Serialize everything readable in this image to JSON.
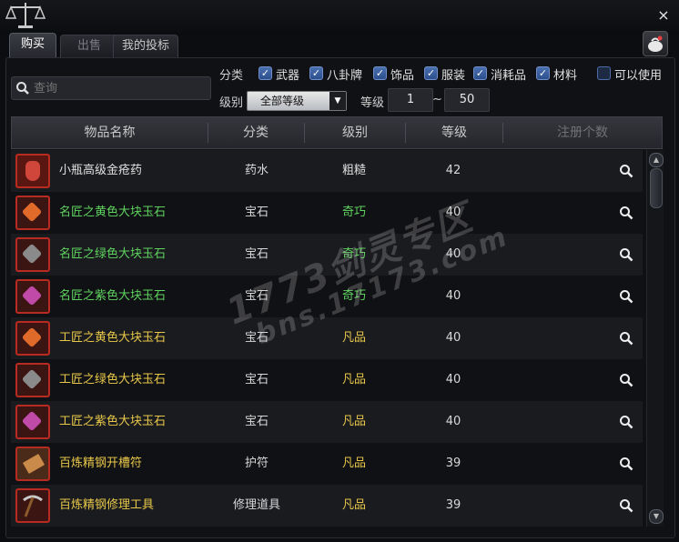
{
  "window": {
    "close_glyph": "×",
    "icons": [
      "scale-icon",
      "close-icon",
      "bag-icon"
    ]
  },
  "tabs": [
    {
      "label": "购买",
      "active": true
    },
    {
      "label": "出售",
      "active": false
    },
    {
      "label": "我的投标",
      "active": false
    }
  ],
  "search": {
    "placeholder": "查询"
  },
  "filters": {
    "category_label": "分类",
    "categories": [
      {
        "label": "武器",
        "checked": true
      },
      {
        "label": "八卦牌",
        "checked": true
      },
      {
        "label": "饰品",
        "checked": true
      },
      {
        "label": "服装",
        "checked": true
      },
      {
        "label": "消耗品",
        "checked": true
      },
      {
        "label": "材料",
        "checked": true
      }
    ],
    "usable": {
      "label": "可以使用",
      "checked": false
    },
    "grade_label": "级别",
    "grade_value": "全部等级",
    "level_label": "等级",
    "level_min": "1",
    "level_sep": "~",
    "level_max": "50"
  },
  "table": {
    "headers": [
      "物品名称",
      "分类",
      "级别",
      "等级",
      "注册个数"
    ],
    "rows": [
      {
        "name": "小瓶高级金疮药",
        "category": "药水",
        "grade": "粗糙",
        "level": "42"
      },
      {
        "name": "名匠之黄色大块玉石",
        "category": "宝石",
        "grade": "奇巧",
        "level": "40"
      },
      {
        "name": "名匠之绿色大块玉石",
        "category": "宝石",
        "grade": "奇巧",
        "level": "40"
      },
      {
        "name": "名匠之紫色大块玉石",
        "category": "宝石",
        "grade": "奇巧",
        "level": "40"
      },
      {
        "name": "工匠之黄色大块玉石",
        "category": "宝石",
        "grade": "凡品",
        "level": "40"
      },
      {
        "name": "工匠之绿色大块玉石",
        "category": "宝石",
        "grade": "凡品",
        "level": "40"
      },
      {
        "name": "工匠之紫色大块玉石",
        "category": "宝石",
        "grade": "凡品",
        "level": "40"
      },
      {
        "name": "百炼精钢开槽符",
        "category": "护符",
        "grade": "凡品",
        "level": "39"
      },
      {
        "name": "百炼精钢修理工具",
        "category": "修理道具",
        "grade": "凡品",
        "level": "39"
      }
    ]
  },
  "colors": {
    "grade_coarse": "#e0e0e0",
    "grade_skillful": "#5fd35f",
    "grade_common": "#e8c84a",
    "gem_yellow": "#e06a2a",
    "gem_green": "#8a8a8a",
    "gem_purple": "#c04aa8"
  },
  "watermark": {
    "line1": "1773剑灵专区",
    "line2": "bns.17173.com"
  }
}
